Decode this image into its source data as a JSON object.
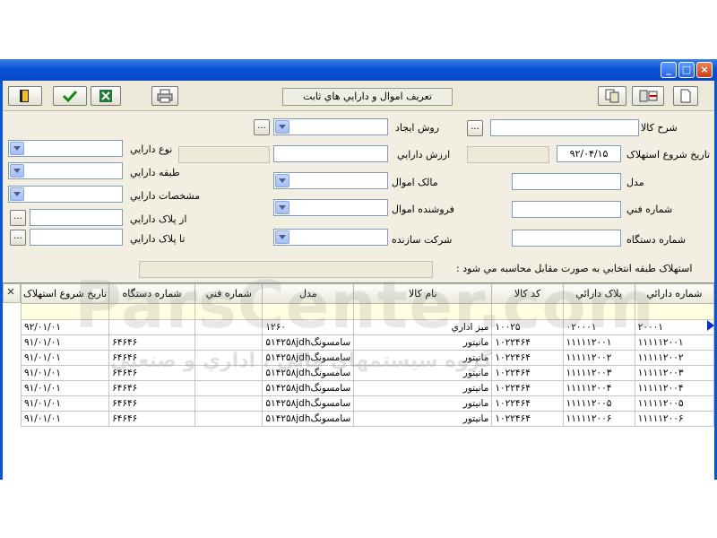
{
  "toolbar": {
    "form_title": "تعريف اموال و دارايي هاي ثابت"
  },
  "form": {
    "sharh_kala_label": "شرح کالا",
    "sharh_kala_value": "",
    "ravesh_ijad_label": "روش ايجاد",
    "tarikh_label": "تاريخ شروع استهلاک",
    "tarikh_value": "۹۲/۰۴/۱۵",
    "arzesh_label": "ارزش دارايي",
    "noe_label": "نوع دارايي",
    "tabaqe_label": "طبقه دارايي",
    "model_label": "مدل",
    "malek_label": "مالک اموال",
    "moshakhasat_label": "مشخصات دارايي",
    "shomare_fanni_label": "شماره فني",
    "forushande_label": "فروشنده اموال",
    "az_pelak_label": "از پلاک دارايي",
    "shomare_dastgah_label": "شماره دستگاه",
    "sherkat_label": "شرکت سازنده",
    "ta_pelak_label": "تا پلاک دارايي",
    "estehlak_note": "استهلاک طبقه انتخابي به صورت مقابل محاسبه مي شود :",
    "browse_label": "..."
  },
  "grid": {
    "columns": [
      "شماره دارائي",
      "پلاک دارائي",
      "کد کالا",
      "نام کالا",
      "مدل",
      "شماره فني",
      "شماره دستگاه",
      "تاريخ شروع استهلاک"
    ],
    "rows": [
      [
        "۲۰۰۰۱",
        "۰۲۰۰۰۱",
        "۱۰۰۲۵",
        "ميز اداري",
        "۱۲۶۰",
        "",
        "",
        "۹۲/۰۱/۰۱"
      ],
      [
        "۱۱۱۱۱۲۰۰۱",
        "۱۱۱۱۱۲۰۰۱",
        "۱۰۲۲۴۶۴",
        "مانيتور",
        "۵۱۴۲۵۸jdhسامسونگ",
        "",
        "۶۴۶۴۶",
        "۹۱/۰۱/۰۱"
      ],
      [
        "۱۱۱۱۱۲۰۰۲",
        "۱۱۱۱۱۲۰۰۲",
        "۱۰۲۲۴۶۴",
        "مانيتور",
        "۵۱۴۲۵۸jdhسامسونگ",
        "",
        "۶۴۶۴۶",
        "۹۱/۰۱/۰۱"
      ],
      [
        "۱۱۱۱۱۲۰۰۳",
        "۱۱۱۱۱۲۰۰۳",
        "۱۰۲۲۴۶۴",
        "مانيتور",
        "۵۱۴۲۵۸jdhسامسونگ",
        "",
        "۶۴۶۴۶",
        "۹۱/۰۱/۰۱"
      ],
      [
        "۱۱۱۱۱۲۰۰۴",
        "۱۱۱۱۱۲۰۰۴",
        "۱۰۲۲۴۶۴",
        "مانيتور",
        "۵۱۴۲۵۸jdhسامسونگ",
        "",
        "۶۴۶۴۶",
        "۹۱/۰۱/۰۱"
      ],
      [
        "۱۱۱۱۱۲۰۰۵",
        "۱۱۱۱۱۲۰۰۵",
        "۱۰۲۲۴۶۴",
        "مانيتور",
        "۵۱۴۲۵۸jdhسامسونگ",
        "",
        "۶۴۶۴۶",
        "۹۱/۰۱/۰۱"
      ],
      [
        "۱۱۱۱۱۲۰۰۶",
        "۱۱۱۱۱۲۰۰۶",
        "۱۰۲۲۴۶۴",
        "مانيتور",
        "۵۱۴۲۵۸jdhسامسونگ",
        "",
        "۶۴۶۴۶",
        "۹۱/۰۱/۰۱"
      ]
    ]
  },
  "watermark": {
    "brand": "ParsCenter.com",
    "tagline": "گروه سيستمهاي مالي ، اداري و صنعتي"
  },
  "colors": {
    "titlebar": "#0a54d6",
    "window_bg": "#f2efe2",
    "filter_row": "#ffffe1"
  }
}
